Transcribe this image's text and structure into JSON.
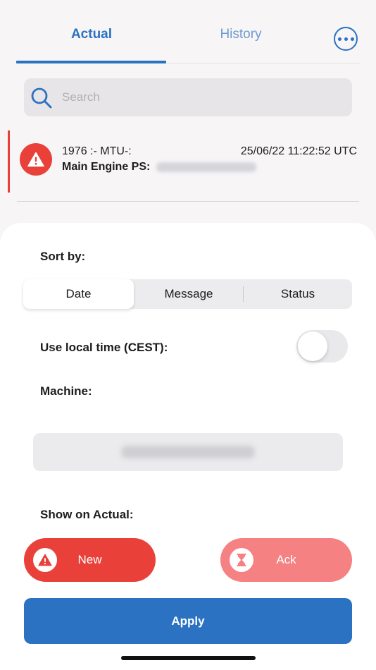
{
  "tabs": {
    "actual_label": "Actual",
    "history_label": "History",
    "active": "Actual",
    "more_icon": "ellipsis-circle-icon"
  },
  "search": {
    "placeholder": "Search",
    "value": "",
    "icon": "search-icon"
  },
  "alarms": [
    {
      "code": "1976 :- MTU-:",
      "timestamp": "25/06/22 11:22:52 UTC",
      "message_prefix": "Main Engine PS:",
      "status": "new",
      "icon": "warning-icon"
    }
  ],
  "sheet": {
    "sort_by_label": "Sort by:",
    "sort_options": [
      "Date",
      "Message",
      "Status"
    ],
    "sort_selected": "Date",
    "local_time_label": "Use local time (CEST):",
    "local_time_enabled": false,
    "machine_label": "Machine:",
    "show_on_actual_label": "Show on Actual:",
    "filters": {
      "new_label": "New",
      "new_icon": "warning-icon",
      "ack_label": "Ack",
      "ack_icon": "hourglass-icon"
    },
    "apply_label": "Apply"
  },
  "colors": {
    "accent": "#2b72c2",
    "alarm_red": "#e9413a",
    "ack_pink": "#f58183"
  }
}
